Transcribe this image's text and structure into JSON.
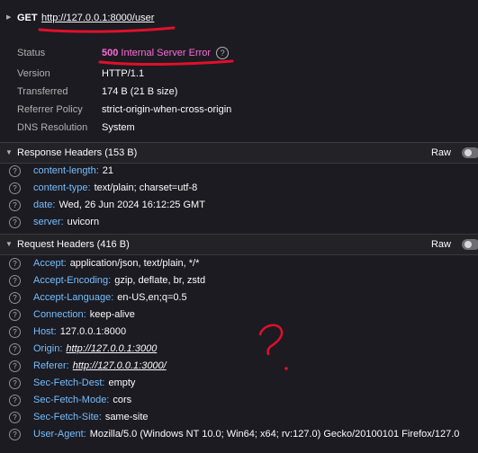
{
  "request": {
    "method": "GET",
    "url": "http://127.0.0.1:8000/user"
  },
  "summary": {
    "status_label": "Status",
    "status_code": "500",
    "status_text": "Internal Server Error",
    "help_icon": "?",
    "rows": [
      {
        "key": "Version",
        "value": "HTTP/1.1"
      },
      {
        "key": "Transferred",
        "value": "174 B (21 B size)"
      },
      {
        "key": "Referrer Policy",
        "value": "strict-origin-when-cross-origin"
      },
      {
        "key": "DNS Resolution",
        "value": "System"
      }
    ]
  },
  "response_headers": {
    "title": "Response Headers (153 B)",
    "raw_label": "Raw",
    "items": [
      {
        "name": "content-length:",
        "value": "21"
      },
      {
        "name": "content-type:",
        "value": "text/plain; charset=utf-8"
      },
      {
        "name": "date:",
        "value": "Wed, 26 Jun 2024 16:12:25 GMT"
      },
      {
        "name": "server:",
        "value": "uvicorn"
      }
    ]
  },
  "request_headers": {
    "title": "Request Headers (416 B)",
    "raw_label": "Raw",
    "items": [
      {
        "name": "Accept:",
        "value": "application/json, text/plain, */*"
      },
      {
        "name": "Accept-Encoding:",
        "value": "gzip, deflate, br, zstd"
      },
      {
        "name": "Accept-Language:",
        "value": "en-US,en;q=0.5"
      },
      {
        "name": "Connection:",
        "value": "keep-alive"
      },
      {
        "name": "Host:",
        "value": "127.0.0.1:8000"
      },
      {
        "name": "Origin:",
        "value": "http://127.0.0.1:3000"
      },
      {
        "name": "Referer:",
        "value": "http://127.0.0.1:3000/"
      },
      {
        "name": "Sec-Fetch-Dest:",
        "value": "empty"
      },
      {
        "name": "Sec-Fetch-Mode:",
        "value": "cors"
      },
      {
        "name": "Sec-Fetch-Site:",
        "value": "same-site"
      },
      {
        "name": "User-Agent:",
        "value": "Mozilla/5.0 (Windows NT 10.0; Win64; x64; rv:127.0) Gecko/20100101 Firefox/127.0"
      }
    ]
  },
  "colors": {
    "background": "#1c1b22",
    "header_name": "#75bfff",
    "status": "#ff6bd5",
    "annotation": "#e0102a"
  }
}
